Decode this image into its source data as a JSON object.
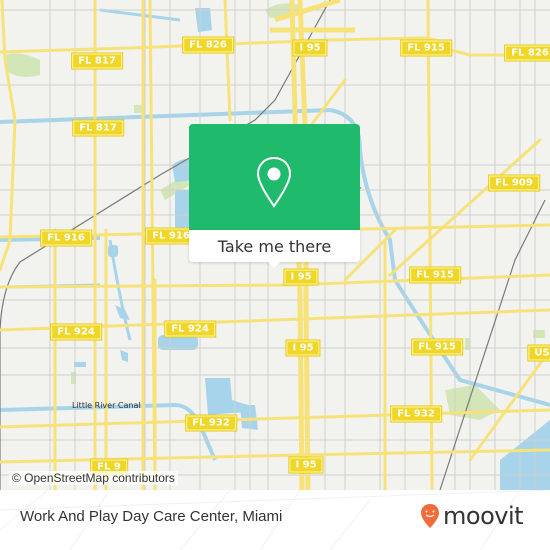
{
  "map": {
    "attribution": "© OpenStreetMap contributors",
    "colors": {
      "background": "#f2f2ef",
      "major_road": "#f7e27a",
      "minor_road": "#cfcfcf",
      "water": "#a7d4ea",
      "park": "#cfe5b1",
      "railway": "#707070",
      "shield": "#f0d626"
    },
    "road_shields": [
      {
        "label": "FL 826",
        "id": "fl826-west"
      },
      {
        "label": "I 95",
        "id": "i95-north"
      },
      {
        "label": "FL 915",
        "id": "fl915-north"
      },
      {
        "label": "FL 826",
        "id": "fl826-east"
      },
      {
        "label": "FL 817",
        "id": "fl817-north"
      },
      {
        "label": "FL 817",
        "id": "fl817-south"
      },
      {
        "label": "FL 909",
        "id": "fl909"
      },
      {
        "label": "FL 916",
        "id": "fl916-west"
      },
      {
        "label": "FL 916",
        "id": "fl916-east"
      },
      {
        "label": "I 95",
        "id": "i95-mid"
      },
      {
        "label": "FL 915",
        "id": "fl915-mid"
      },
      {
        "label": "FL 924",
        "id": "fl924-west"
      },
      {
        "label": "FL 924",
        "id": "fl924-east"
      },
      {
        "label": "I 95",
        "id": "i95-south"
      },
      {
        "label": "FL 915",
        "id": "fl915-south"
      },
      {
        "label": "US",
        "id": "us1"
      },
      {
        "label": "FL 932",
        "id": "fl932-west"
      },
      {
        "label": "FL 932",
        "id": "fl932-east"
      },
      {
        "label": "I 95",
        "id": "i95-bottom"
      },
      {
        "label": "FL 9",
        "id": "fl9"
      }
    ],
    "labels": {
      "little_river_canal": "Little River Canal",
      "canal": "Canal"
    }
  },
  "popup": {
    "icon": "location-pin-icon",
    "button_label": "Take me there",
    "color": "#1fba6c"
  },
  "footer": {
    "title": "Work And Play Day Care Center, Miami",
    "brand": "moovit",
    "brand_color": "#f26b3a"
  }
}
